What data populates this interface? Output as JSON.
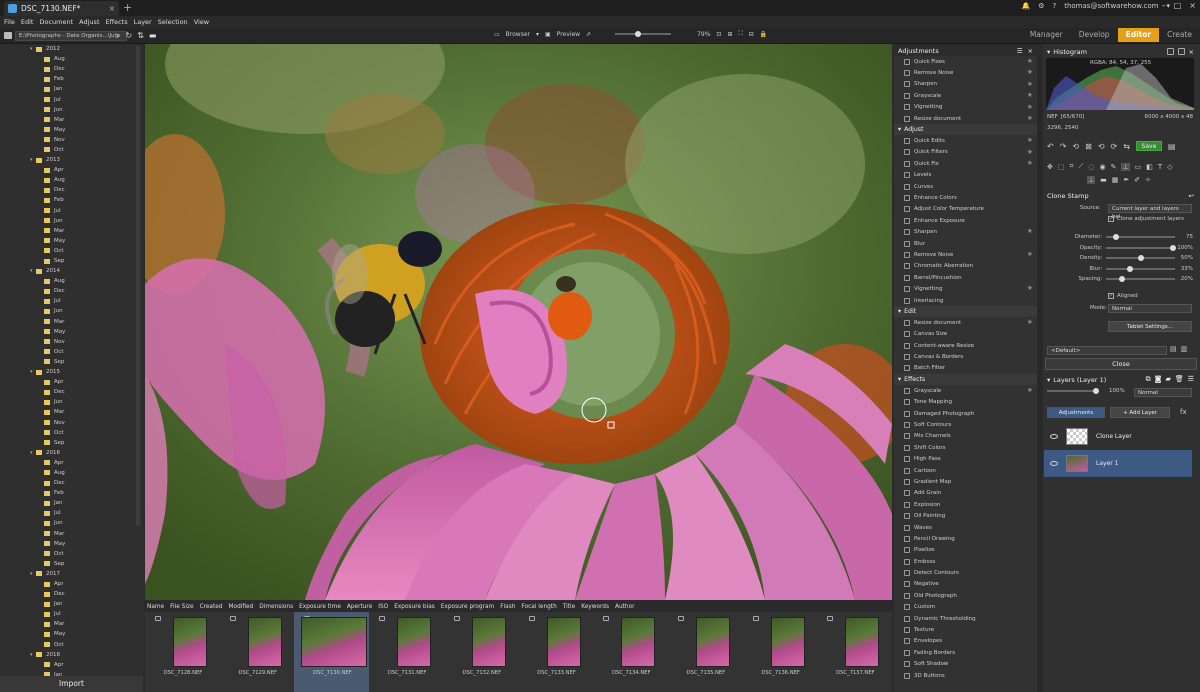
{
  "app": {
    "tab_title": "DSC_7130.NEF*",
    "user": "thomas@softwarehow.com"
  },
  "menu": [
    "File",
    "Edit",
    "Document",
    "Adjust",
    "Effects",
    "Layer",
    "Selection",
    "View"
  ],
  "modes": [
    "Manager",
    "Develop",
    "Editor",
    "Create"
  ],
  "toolbar": {
    "path": "E:\\Photographs - Date Organis...\\July",
    "browser_label": "Browser",
    "preview_label": "Preview",
    "zoom": "79%"
  },
  "tree": [
    {
      "label": "2012",
      "type": "year"
    },
    {
      "label": "Aug"
    },
    {
      "label": "Dec"
    },
    {
      "label": "Feb"
    },
    {
      "label": "Jan"
    },
    {
      "label": "Jul"
    },
    {
      "label": "Jun"
    },
    {
      "label": "Mar"
    },
    {
      "label": "May"
    },
    {
      "label": "Nov"
    },
    {
      "label": "Oct"
    },
    {
      "label": "2013",
      "type": "year"
    },
    {
      "label": "Apr"
    },
    {
      "label": "Aug"
    },
    {
      "label": "Dec"
    },
    {
      "label": "Feb"
    },
    {
      "label": "Jul"
    },
    {
      "label": "Jun"
    },
    {
      "label": "Mar"
    },
    {
      "label": "May"
    },
    {
      "label": "Oct"
    },
    {
      "label": "Sep"
    },
    {
      "label": "2014",
      "type": "year"
    },
    {
      "label": "Aug"
    },
    {
      "label": "Dec"
    },
    {
      "label": "Jul"
    },
    {
      "label": "Jun"
    },
    {
      "label": "Mar"
    },
    {
      "label": "May"
    },
    {
      "label": "Nov"
    },
    {
      "label": "Oct"
    },
    {
      "label": "Sep"
    },
    {
      "label": "2015",
      "type": "year"
    },
    {
      "label": "Apr"
    },
    {
      "label": "Dec"
    },
    {
      "label": "Jun"
    },
    {
      "label": "Mar"
    },
    {
      "label": "Nov"
    },
    {
      "label": "Oct"
    },
    {
      "label": "Sep"
    },
    {
      "label": "2016",
      "type": "year"
    },
    {
      "label": "Apr"
    },
    {
      "label": "Aug"
    },
    {
      "label": "Dec"
    },
    {
      "label": "Feb"
    },
    {
      "label": "Jan"
    },
    {
      "label": "Jul"
    },
    {
      "label": "Jun"
    },
    {
      "label": "Mar"
    },
    {
      "label": "May"
    },
    {
      "label": "Oct"
    },
    {
      "label": "Sep"
    },
    {
      "label": "2017",
      "type": "year"
    },
    {
      "label": "Apr"
    },
    {
      "label": "Dec"
    },
    {
      "label": "Jan"
    },
    {
      "label": "Jul"
    },
    {
      "label": "Mar"
    },
    {
      "label": "May"
    },
    {
      "label": "Oct"
    },
    {
      "label": "2018",
      "type": "year"
    },
    {
      "label": "Apr"
    },
    {
      "label": "Jan"
    }
  ],
  "import_label": "Import",
  "columns": [
    "Name",
    "File Size",
    "Created",
    "Modified",
    "Dimensions",
    "Exposure time",
    "Aperture",
    "ISO",
    "Exposure bias",
    "Exposure program",
    "Flash",
    "Focal length",
    "Title",
    "Keywords",
    "Author"
  ],
  "thumbs": [
    "DSC_7128.NEF",
    "DSC_7129.NEF",
    "DSC_7130.NEF",
    "DSC_7131.NEF",
    "DSC_7132.NEF",
    "DSC_7133.NEF",
    "DSC_7134.NEF",
    "DSC_7135.NEF",
    "DSC_7136.NEF",
    "DSC_7137.NEF"
  ],
  "adjustments": {
    "title": "Adjustments",
    "top_items": [
      {
        "label": "Quick Fixes",
        "star": true
      },
      {
        "label": "Remove Noise",
        "star": true
      },
      {
        "label": "Sharpen",
        "star": true
      },
      {
        "label": "Grayscale",
        "star": true
      },
      {
        "label": "Vignetting",
        "star": true
      },
      {
        "label": "Resize document",
        "star": true
      }
    ],
    "sections": [
      {
        "name": "Adjust",
        "items": [
          {
            "label": "Quick Edits",
            "star": true
          },
          {
            "label": "Quick Filters",
            "star": true
          },
          {
            "label": "Quick Fix",
            "star": true
          },
          {
            "label": "Levels",
            "star": false
          },
          {
            "label": "Curves",
            "star": false
          },
          {
            "label": "Enhance Colors",
            "star": false
          },
          {
            "label": "Adjust Color Temperature",
            "star": false
          },
          {
            "label": "Enhance Exposure",
            "star": false
          },
          {
            "label": "Sharpen",
            "star": true
          },
          {
            "label": "Blur",
            "star": false
          },
          {
            "label": "Remove Noise",
            "star": true
          },
          {
            "label": "Chromatic Aberration",
            "star": false
          },
          {
            "label": "Barrel/Pincushion",
            "star": false
          },
          {
            "label": "Vignetting",
            "star": true
          },
          {
            "label": "Interlacing",
            "star": false
          }
        ]
      },
      {
        "name": "Edit",
        "items": [
          {
            "label": "Resize document",
            "star": true
          },
          {
            "label": "Canvas Size",
            "star": false
          },
          {
            "label": "Content-aware Resize",
            "star": false
          },
          {
            "label": "Canvas & Borders",
            "star": false
          },
          {
            "label": "Batch Filter",
            "star": false
          }
        ]
      },
      {
        "name": "Effects",
        "items": [
          {
            "label": "Grayscale",
            "star": true
          },
          {
            "label": "Tone Mapping",
            "star": false
          },
          {
            "label": "Damaged Photograph",
            "star": false
          },
          {
            "label": "Soft Contours",
            "star": false
          },
          {
            "label": "Mix Channels",
            "star": false
          },
          {
            "label": "Shift Colors",
            "star": false
          },
          {
            "label": "High Pass",
            "star": false
          },
          {
            "label": "Cartoon",
            "star": false
          },
          {
            "label": "Gradient Map",
            "star": false
          },
          {
            "label": "Add Grain",
            "star": false
          },
          {
            "label": "Explosion",
            "star": false
          },
          {
            "label": "Oil Painting",
            "star": false
          },
          {
            "label": "Waves",
            "star": false
          },
          {
            "label": "Pencil Drawing",
            "star": false
          },
          {
            "label": "Pixelize",
            "star": false
          },
          {
            "label": "Emboss",
            "star": false
          },
          {
            "label": "Detect Contours",
            "star": false
          },
          {
            "label": "Negative",
            "star": false
          },
          {
            "label": "Old Photograph",
            "star": false
          },
          {
            "label": "Custom",
            "star": false
          },
          {
            "label": "Dynamic Thresholding",
            "star": false
          },
          {
            "label": "Texture",
            "star": false
          },
          {
            "label": "Envelopes",
            "star": false
          },
          {
            "label": "Fading Borders",
            "star": false
          },
          {
            "label": "Soft Shadow",
            "star": false
          },
          {
            "label": "3D Buttons",
            "star": false
          }
        ]
      }
    ]
  },
  "histogram": {
    "title": "Histogram",
    "rgba": "RGBA: 84, 54, 37, 255",
    "format": "NEF",
    "index": "[65/670]",
    "size": "6000 x 4000 x 48",
    "coords": "3296, 2540"
  },
  "tool": {
    "save_label": "Save",
    "name": "Clone Stamp",
    "source_label": "Source:",
    "source_value": "Current layer and layers bel...",
    "clone_adj_label": "Clone adjustment layers",
    "sliders": [
      {
        "label": "Diameter:",
        "value": "75",
        "pos": 0.1
      },
      {
        "label": "Opacity:",
        "value": "100%",
        "pos": 1.0
      },
      {
        "label": "Density:",
        "value": "50%",
        "pos": 0.5
      },
      {
        "label": "Blur:",
        "value": "33%",
        "pos": 0.33
      },
      {
        "label": "Spacing:",
        "value": "20%",
        "pos": 0.2
      }
    ],
    "aligned_label": "Aligned",
    "mode_label": "Mode:",
    "mode_value": "Normal",
    "tablet_label": "Tablet Settings...",
    "preset": "<Default>",
    "close_label": "Close"
  },
  "layers": {
    "title": "Layers (Layer 1)",
    "opacity": "100%",
    "blend": "Normal",
    "adj_tab": "Adjustments",
    "add_layer": "Add Layer",
    "items": [
      {
        "name": "Clone Layer",
        "selected": false
      },
      {
        "name": "Layer 1",
        "selected": true
      }
    ]
  },
  "colors": {
    "accent": "#e6a018",
    "selection": "#3d5a85"
  }
}
